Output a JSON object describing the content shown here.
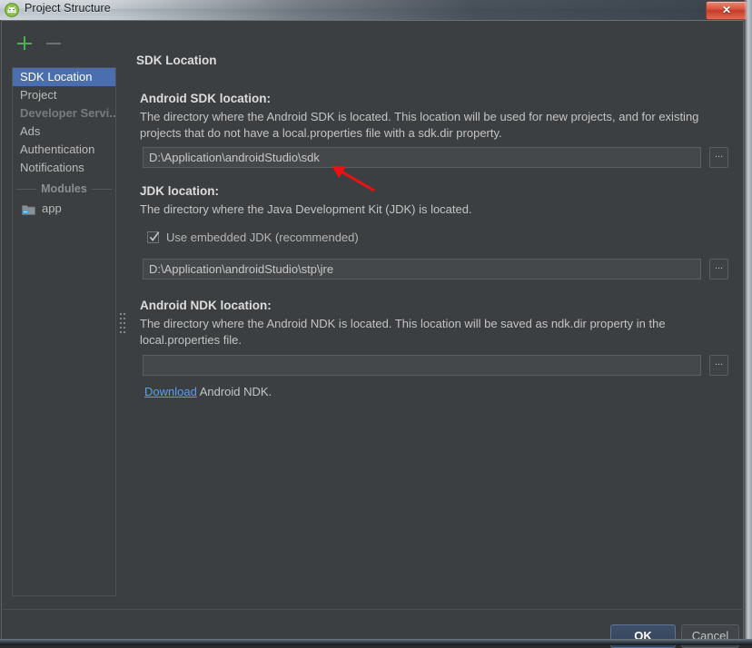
{
  "window": {
    "title": "Project Structure",
    "app_icon": "android-studio-icon",
    "close_label": "✕"
  },
  "toolbar": {
    "add_label": "+",
    "remove_label": "−"
  },
  "sidebar": {
    "items": [
      {
        "label": "SDK Location",
        "state": "selected"
      },
      {
        "label": "Project",
        "state": "normal"
      },
      {
        "label": "Developer Servi...",
        "state": "dim"
      },
      {
        "label": "Ads",
        "state": "normal"
      },
      {
        "label": "Authentication",
        "state": "normal"
      },
      {
        "label": "Notifications",
        "state": "normal"
      }
    ],
    "modules_header": "Modules",
    "modules": [
      {
        "label": "app",
        "icon": "module-folder-icon"
      }
    ]
  },
  "content": {
    "pane_title": "SDK Location",
    "sdk": {
      "title": "Android SDK location:",
      "desc_line1": "The directory where the Android SDK is located. This location will be used for new projects, and for existing",
      "desc_line2": "projects that do not have a local.properties file with a sdk.dir property.",
      "value": "D:\\Application\\androidStudio\\sdk",
      "browse_label": "...",
      "placeholder": ""
    },
    "jdk": {
      "title": "JDK location:",
      "desc_line1": "The directory where the Java Development Kit (JDK) is located.",
      "checkbox_label": "Use embedded JDK (recommended)",
      "checkbox_checked": true,
      "value": "D:\\Application\\androidStudio\\stp\\jre",
      "browse_label": "...",
      "placeholder": ""
    },
    "ndk": {
      "title": "Android NDK location:",
      "desc_line1": "The directory where the Android NDK is located. This location will be saved as ndk.dir property in the",
      "desc_line2": "local.properties file.",
      "value": "",
      "browse_label": "...",
      "placeholder": "",
      "download_link": "Download",
      "download_suffix": " Android NDK."
    }
  },
  "footer": {
    "ok_label": "OK",
    "cancel_label": "Cancel"
  },
  "annotation": {
    "type": "red-arrow",
    "color": "#ee1111"
  },
  "colors": {
    "dialog_bg": "#3c3f41",
    "selection_blue": "#4b6eaf",
    "link_blue": "#589df6",
    "add_green": "#4caf50",
    "close_red": "#d9503b",
    "field_bg": "#45484a"
  }
}
